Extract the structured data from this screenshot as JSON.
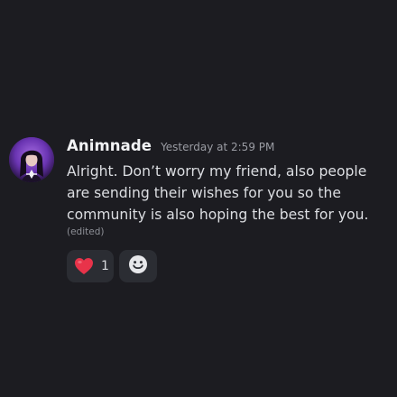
{
  "message": {
    "username": "Animnade",
    "timestamp": "Yesterday at 2:59 PM",
    "content_lines": [
      "Alright. Don’t worry my friend, also people",
      "are sending their wishes for you so the",
      "community is also hoping the best for you."
    ],
    "edited_label": "(edited)",
    "avatar_icon": "user-avatar"
  },
  "reactions": [
    {
      "emoji": "heart-icon",
      "count": "1",
      "color": "#e8334a"
    },
    {
      "emoji": "add-reaction-icon"
    }
  ],
  "colors": {
    "background": "#1c1c21",
    "username": "#f2f3f5",
    "text": "#dcdee2",
    "muted": "#9a9ca3",
    "reaction_bg": "#2b2d33"
  }
}
